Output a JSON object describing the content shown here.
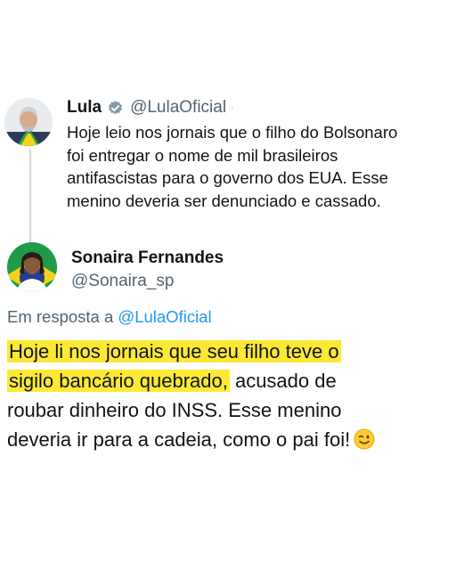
{
  "tweet": {
    "display_name": "Lula",
    "handle": "@LulaOficial",
    "separator": "·",
    "text_lines": [
      "Hoje leio nos jornais que o filho do Bolsonaro",
      "foi entregar o nome de mil brasileiros",
      "antifascistas para o governo dos EUA. Esse",
      "menino deveria ser denunciado e cassado."
    ]
  },
  "reply": {
    "display_name": "Sonaira Fernandes",
    "handle": "@Sonaira_sp",
    "reply_prefix": "Em resposta a",
    "reply_mention": "@LulaOficial",
    "highlight_1": "Hoje li nos jornais que seu filho teve o",
    "highlight_2": "sigilo bancário quebrado,",
    "rest_line_2": " acusado de",
    "line_3": "roubar dinheiro do INSS. Esse menino",
    "line_4": "deveria ir para a cadeia, como o pai foi!",
    "emoji": "winking-face"
  },
  "colors": {
    "highlight": "#fde935",
    "verified_badge": "#829aab",
    "link": "#1d9bf0",
    "secondary_text": "#536471",
    "thread_line": "#cfd9de"
  },
  "icons": [
    "verified-badge-icon",
    "winking-face-emoji"
  ]
}
